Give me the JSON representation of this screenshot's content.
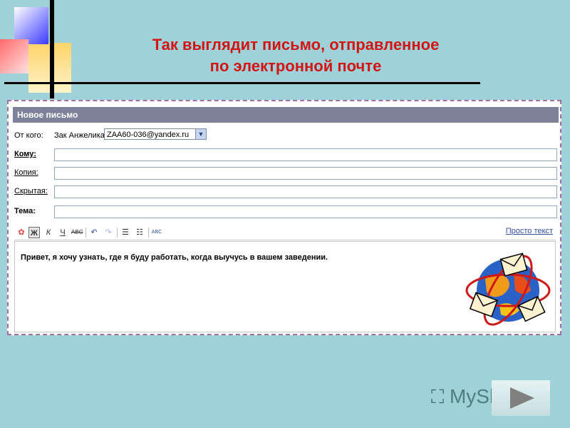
{
  "slide": {
    "title_line1": "Так выглядит письмо, отправленное",
    "title_line2": "по электронной почте"
  },
  "mail": {
    "header": "Новое письмо",
    "from_label": "От кого:",
    "from_name": "Зак Анжелика",
    "from_email": "ZAA60-036@yandex.ru",
    "to_label": "Кому:",
    "cc_label": "Копия:",
    "bcc_label": "Скрытая:",
    "subject_label": "Тема:",
    "plain_text_link": "Просто текст",
    "body_text": "Привет,  я хочу узнать, где я буду работать, когда выучусь в вашем заведении."
  },
  "toolbar": {
    "bold_glyph": "Ж",
    "italic_glyph": "К",
    "underline_glyph": "Ч",
    "strike_glyph": "ABC",
    "spell_glyph": "ABC"
  },
  "watermark": {
    "text": "MyShared"
  },
  "colors": {
    "background": "#9fd1d8",
    "title": "#d21414",
    "header_bar": "#7d8199",
    "link": "#2f4fa3"
  }
}
